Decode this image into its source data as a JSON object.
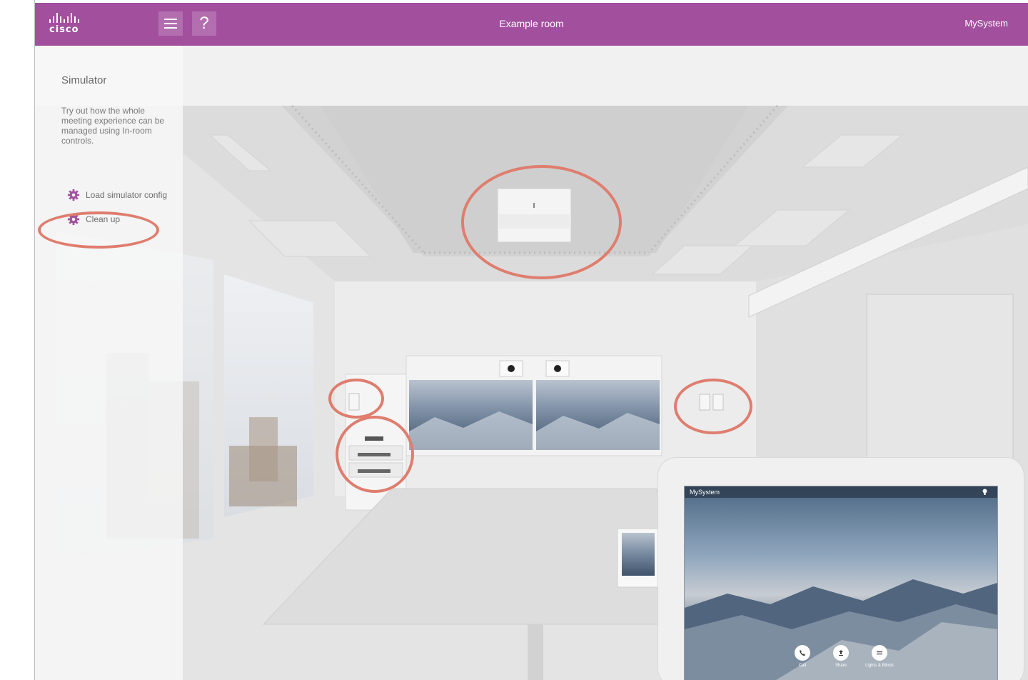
{
  "header": {
    "logo_text": "cisco",
    "menu_icon": "hamburger-icon",
    "help_label": "?",
    "room_title": "Example room",
    "system_name": "MySystem"
  },
  "sidebar": {
    "title": "Simulator",
    "description": "Try out how the whole meeting experience can be managed using In-room controls.",
    "items": [
      {
        "label": "Load simulator config",
        "icon": "gear-icon"
      },
      {
        "label": "Clean up",
        "icon": "gear-icon"
      }
    ]
  },
  "touch_panel": {
    "system_name": "MySystem",
    "status_icon": "lightbulb-icon",
    "buttons": [
      {
        "label": "Call",
        "icon": "phone-icon"
      },
      {
        "label": "Share",
        "icon": "share-icon"
      },
      {
        "label": "Lights & Blinds",
        "icon": "sliders-icon"
      }
    ]
  },
  "colors": {
    "brand": "#a24f9e",
    "highlight_ring": "#df7d6e",
    "gear": "#a24f9e"
  }
}
